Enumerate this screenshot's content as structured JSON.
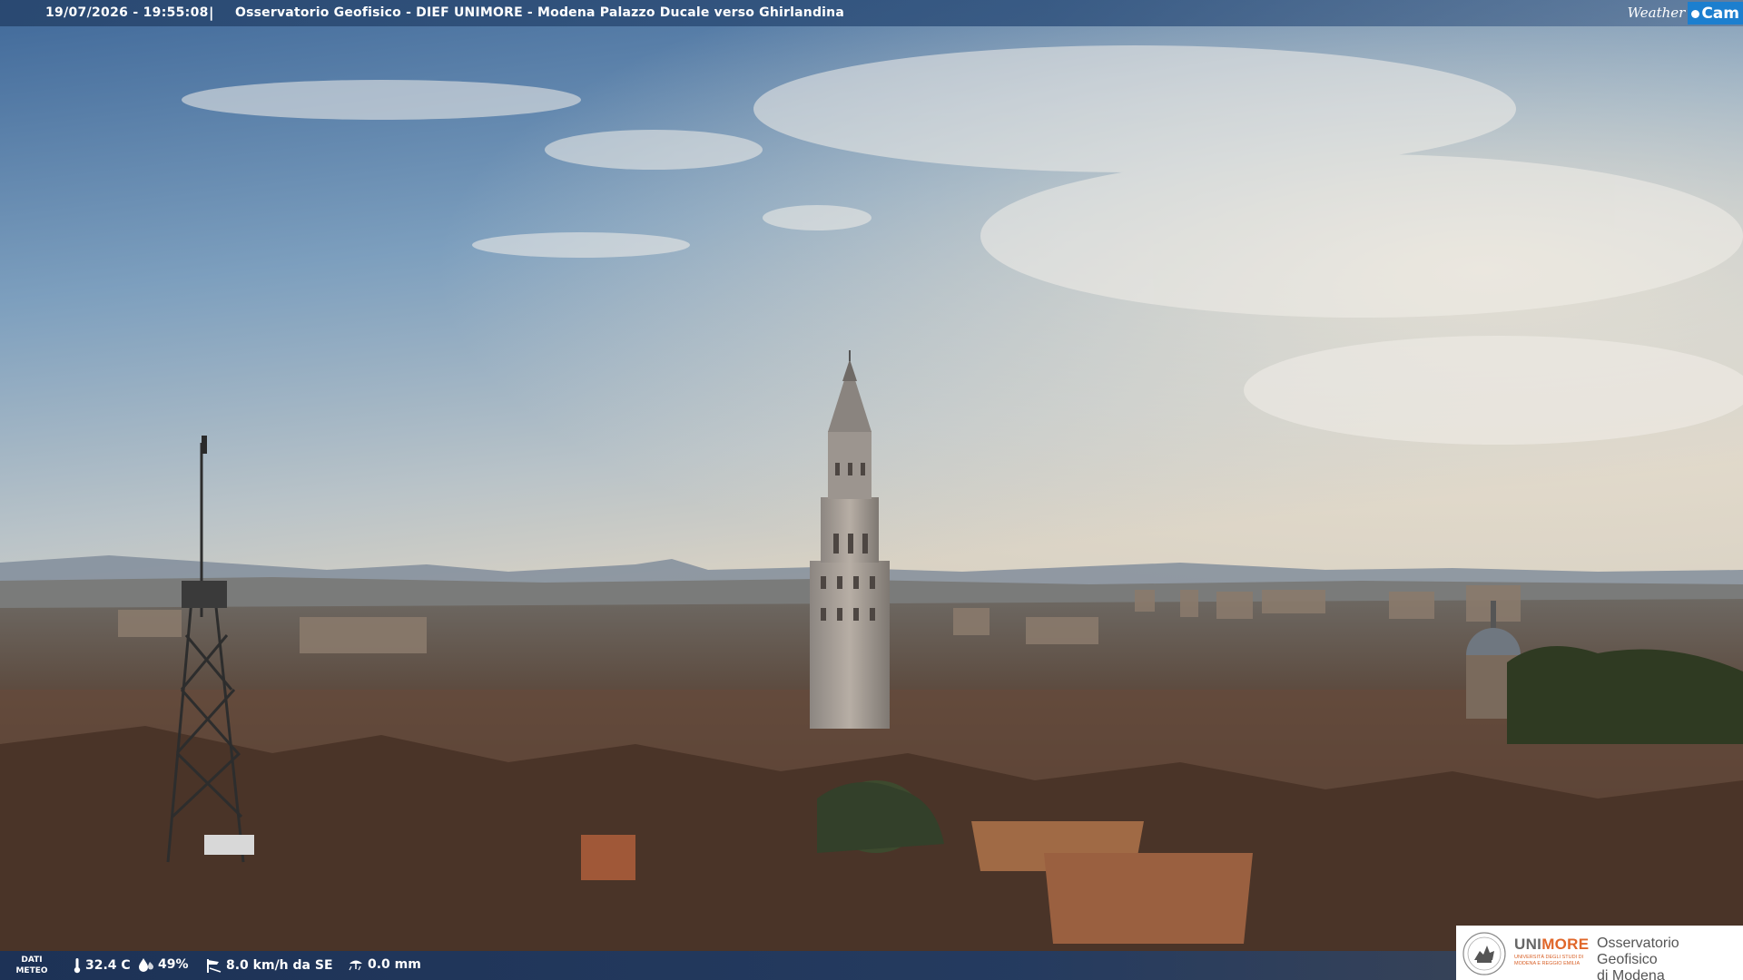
{
  "top_bar": {
    "datetime": "19/07/2026 - 19:55:08",
    "separator": "|",
    "title": "Osservatorio Geofisico - DIEF UNIMORE - Modena Palazzo Ducale verso Ghirlandina"
  },
  "watermark": {
    "weather_text": "Weather",
    "cam_text": "Cam"
  },
  "weather_bar": {
    "label_line1": "DATI",
    "label_line2": "METEO",
    "temperature": "32.4 C",
    "humidity": "49%",
    "wind": "8.0 km/h da SE",
    "rain": "0.0 mm",
    "icons": [
      "thermometer-icon",
      "humidity-drop-icon",
      "wind-icon",
      "rain-gauge-icon"
    ]
  },
  "institution_logo": {
    "uni_prefix": "UNI",
    "uni_suffix": "MORE",
    "uni_subtitle": "UNIVERSITÀ DEGLI STUDI DI MODENA E REGGIO EMILIA",
    "observatory_line1": "Osservatorio Geofisico",
    "observatory_line2": "di Modena"
  },
  "colors": {
    "bar_blue": "#28466e",
    "webcam_blue": "#1c7fcf",
    "unimore_orange": "#e0672a"
  }
}
